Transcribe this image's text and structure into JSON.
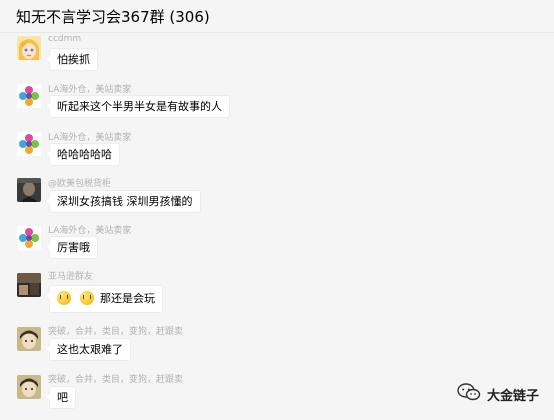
{
  "header": {
    "title": "知无不言学习会367群 (306)"
  },
  "messages": [
    {
      "sender": "ccdmm",
      "text": "怕挨抓",
      "avatar": "anime-girl-avatar"
    },
    {
      "sender": "LA海外仓，美站卖家",
      "text": "听起来这个半男半女是有故事的人",
      "avatar": "flower-logo-avatar"
    },
    {
      "sender": "LA海外仓，美站卖家",
      "text": "哈哈哈哈哈",
      "avatar": "flower-logo-avatar"
    },
    {
      "sender": "@欧美包税货柜",
      "text": "深圳女孩搞钱  深圳男孩懂的",
      "avatar": "dark-photo-avatar"
    },
    {
      "sender": "LA海外仓，美站卖家",
      "text": "厉害哦",
      "avatar": "flower-logo-avatar"
    },
    {
      "sender": "亚马逊群友",
      "text": "那还是会玩",
      "avatar": "landscape-photo-avatar"
    },
    {
      "sender": "突破，合并，类目，变狗，赶跟卖",
      "text": "这也太艰难了",
      "avatar": "anime-boy-avatar"
    },
    {
      "sender": "突破，合并，类目，变狗，赶跟卖",
      "text": "吧",
      "avatar": "anime-boy-avatar"
    }
  ],
  "watermark": {
    "text": "大金链子"
  },
  "colors": {
    "background": "#f5f5f5",
    "bubble": "#ffffff",
    "sender": "#b2b2b2"
  }
}
